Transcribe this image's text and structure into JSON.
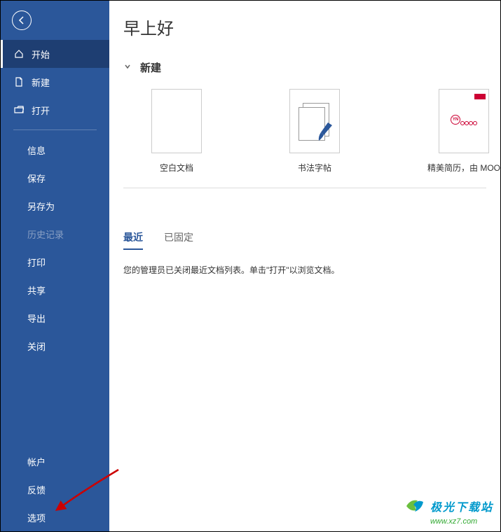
{
  "greeting": "早上好",
  "sidebar": {
    "items": [
      {
        "label": "开始",
        "icon": "home"
      },
      {
        "label": "新建",
        "icon": "document"
      },
      {
        "label": "打开",
        "icon": "folder"
      }
    ],
    "file_ops": [
      {
        "label": "信息"
      },
      {
        "label": "保存"
      },
      {
        "label": "另存为"
      },
      {
        "label": "历史记录",
        "disabled": true
      },
      {
        "label": "打印"
      },
      {
        "label": "共享"
      },
      {
        "label": "导出"
      },
      {
        "label": "关闭"
      }
    ],
    "bottom": [
      {
        "label": "帐户"
      },
      {
        "label": "反馈"
      },
      {
        "label": "选项"
      }
    ]
  },
  "new_section": {
    "title": "新建",
    "templates": [
      {
        "label": "空白文档"
      },
      {
        "label": "书法字帖"
      },
      {
        "label": "精美简历，由 MOO",
        "logo_text": "YN"
      }
    ]
  },
  "tabs": {
    "recent": "最近",
    "pinned": "已固定"
  },
  "info_message": "您的管理员已关闭最近文档列表。单击\"打开\"以浏览文档。",
  "watermark": {
    "name": "极光下载站",
    "url": "www.xz7.com"
  }
}
